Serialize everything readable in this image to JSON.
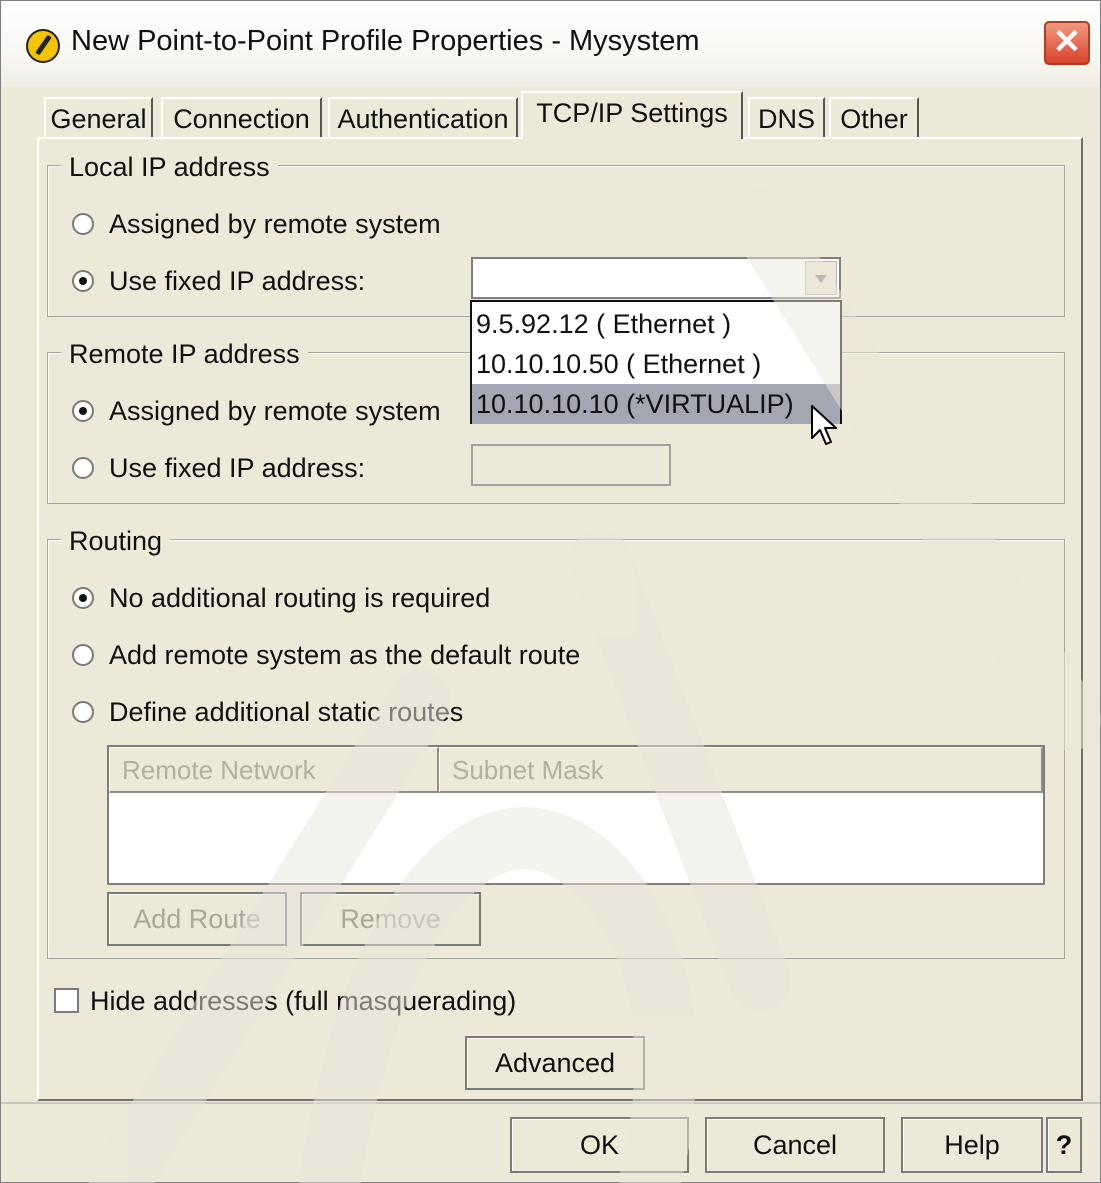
{
  "window": {
    "title": "New Point-to-Point Profile Properties - Mysystem",
    "close_glyph": "✕"
  },
  "tabs": [
    {
      "label": "General"
    },
    {
      "label": "Connection"
    },
    {
      "label": "Authentication"
    },
    {
      "label": "TCP/IP Settings"
    },
    {
      "label": "DNS"
    },
    {
      "label": "Other"
    }
  ],
  "active_tab": "TCP/IP Settings",
  "local_ip": {
    "legend": "Local IP address",
    "option_assigned": "Assigned by remote system",
    "option_fixed": "Use fixed IP address:",
    "selected": "fixed",
    "combo_value": "",
    "dropdown_options": [
      "9.5.92.12 ( Ethernet )",
      "10.10.10.50 ( Ethernet )",
      "10.10.10.10 (*VIRTUALIP)"
    ],
    "highlighted_option": "10.10.10.10 (*VIRTUALIP)"
  },
  "remote_ip": {
    "legend": "Remote IP address",
    "option_assigned": "Assigned by remote system",
    "option_fixed": "Use fixed IP address:",
    "selected": "assigned",
    "field_value": ""
  },
  "routing": {
    "legend": "Routing",
    "option_none": "No additional routing is required",
    "option_default": "Add remote system as the default route",
    "option_static": "Define additional static routes",
    "selected": "none",
    "table_headers": [
      "Remote Network",
      "Subnet Mask"
    ],
    "add_route_label": "Add Route",
    "remove_label": "Remove"
  },
  "hide_addresses": {
    "label": "Hide addresses (full masquerading)",
    "checked": false
  },
  "advanced_label": "Advanced",
  "footer": {
    "ok_label": "OK",
    "cancel_label": "Cancel",
    "help_label": "Help",
    "help_icon_label": "?"
  },
  "colors": {
    "dialog_bg": "#ece9d8",
    "selected_item_bg": "#a4a7b3",
    "close_button": "#d8442a",
    "disabled_text": "#a9a89e"
  }
}
